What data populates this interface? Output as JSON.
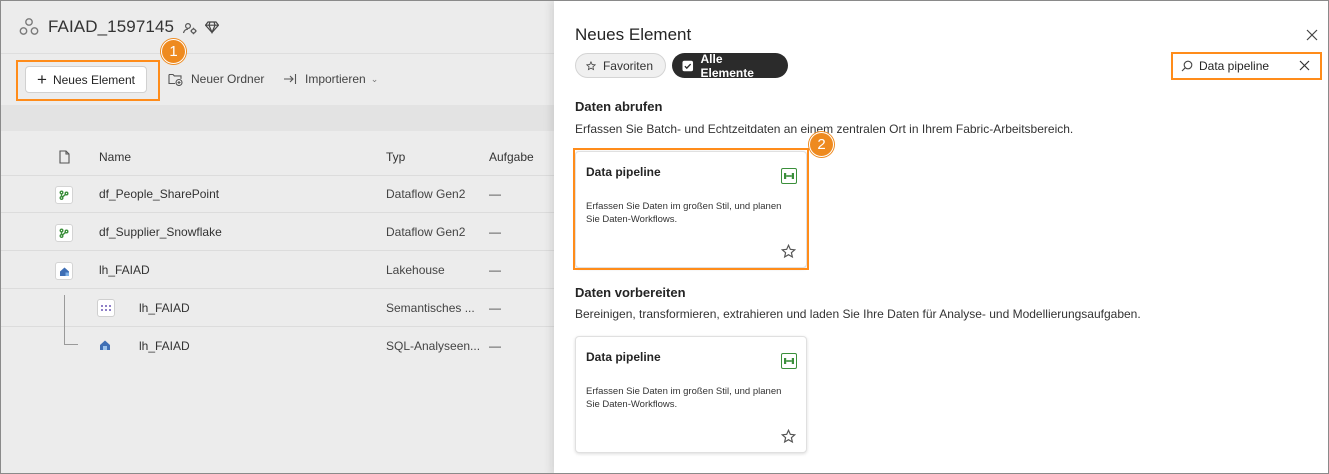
{
  "workspace": {
    "title": "FAIAD_1597145",
    "toolbar": {
      "new_item": "Neues Element",
      "new_folder": "Neuer Ordner",
      "import": "Importieren"
    },
    "table": {
      "headers": {
        "name": "Name",
        "type": "Typ",
        "task": "Aufgabe"
      },
      "rows": [
        {
          "name": "df_People_SharePoint",
          "type": "Dataflow Gen2",
          "task": "—"
        },
        {
          "name": "df_Supplier_Snowflake",
          "type": "Dataflow Gen2",
          "task": "—"
        },
        {
          "name": "lh_FAIAD",
          "type": "Lakehouse",
          "task": "—"
        },
        {
          "name": "lh_FAIAD",
          "type": "Semantisches ...",
          "task": "—"
        },
        {
          "name": "lh_FAIAD",
          "type": "SQL-Analyseen...",
          "task": "—"
        }
      ]
    }
  },
  "panel": {
    "title": "Neues Element",
    "filters": {
      "favorites": "Favoriten",
      "all_items": "Alle Elemente"
    },
    "search": {
      "value": "Data pipeline"
    },
    "sections": [
      {
        "title": "Daten abrufen",
        "description": "Erfassen Sie Batch- und Echtzeitdaten an einem zentralen Ort in Ihrem Fabric-Arbeitsbereich.",
        "card": {
          "title": "Data pipeline",
          "description": "Erfassen Sie Daten im großen Stil, und planen Sie Daten-Workflows."
        }
      },
      {
        "title": "Daten vorbereiten",
        "description": "Bereinigen, transformieren, extrahieren und laden Sie Ihre Daten für Analyse- und Modellierungsaufgaben.",
        "card": {
          "title": "Data pipeline",
          "description": "Erfassen Sie Daten im großen Stil, und planen Sie Daten-Workflows."
        }
      }
    ]
  },
  "annotations": {
    "step1": "1",
    "step2": "2"
  },
  "colors": {
    "highlight": "#ff8c1a",
    "badge": "#ee8a1f",
    "active_pill": "#2b2b2b",
    "dataflow_green": "#3a8f3a",
    "lakehouse_blue": "#3f6fb5"
  }
}
